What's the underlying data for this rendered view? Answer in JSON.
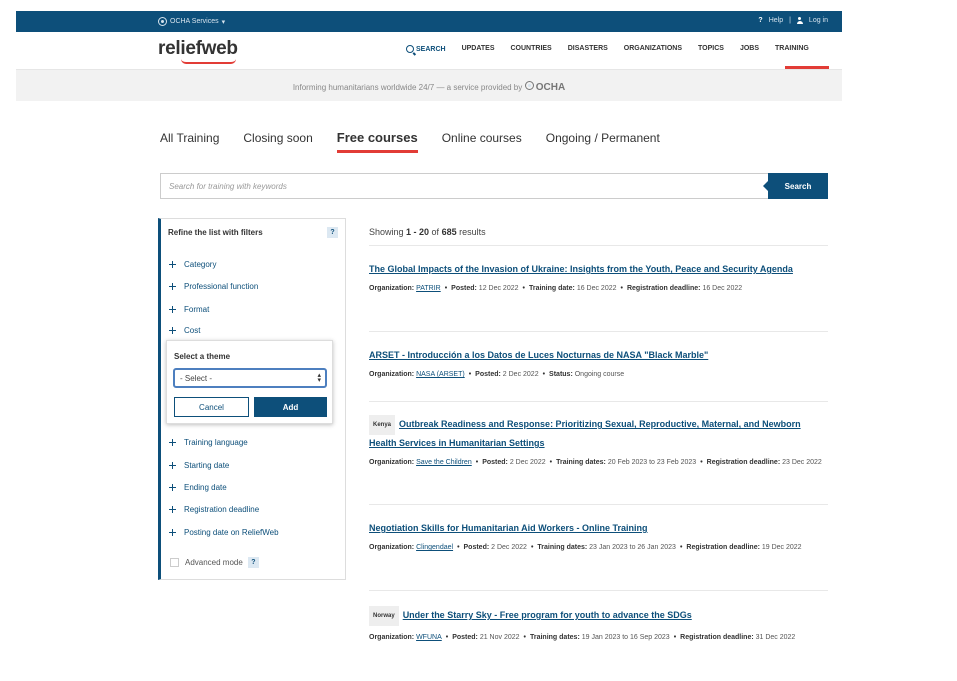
{
  "topbar": {
    "services": "OCHA Services",
    "help": "Help",
    "login": "Log in",
    "separator": "|"
  },
  "header": {
    "logo": "reliefweb",
    "nav": [
      "SEARCH",
      "UPDATES",
      "COUNTRIES",
      "DISASTERS",
      "ORGANIZATIONS",
      "TOPICS",
      "JOBS",
      "TRAINING"
    ],
    "active_nav": "TRAINING"
  },
  "tagline": {
    "text": "Informing humanitarians worldwide 24/7 — a service provided by",
    "brand": "OCHA"
  },
  "tabs": [
    "All Training",
    "Closing soon",
    "Free courses",
    "Online courses",
    "Ongoing / Permanent"
  ],
  "active_tab": "Free courses",
  "search": {
    "placeholder": "Search for training with keywords",
    "button": "Search"
  },
  "filters": {
    "heading": "Refine the list with filters",
    "help": "?",
    "items_top": [
      "Category",
      "Professional function",
      "Format",
      "Cost"
    ],
    "items_bottom": [
      "Training language",
      "Starting date",
      "Ending date",
      "Registration deadline",
      "Posting date on ReliefWeb"
    ],
    "advanced_mode": "Advanced mode",
    "popup": {
      "label": "Select a theme",
      "select_value": "- Select -",
      "cancel": "Cancel",
      "add": "Add"
    }
  },
  "results": {
    "showing_prefix": "Showing ",
    "range": "1 - 20",
    "of": " of ",
    "total": "685",
    "suffix": " results",
    "items": [
      {
        "tag": "",
        "title": "The Global Impacts of the Invasion of Ukraine: Insights from the Youth, Peace and Security Agenda",
        "meta": [
          {
            "label": "Organization:",
            "value": "PATRIR",
            "link": true
          },
          {
            "label": "Posted:",
            "value": "12 Dec 2022"
          },
          {
            "label": "Training date:",
            "value": "16 Dec 2022"
          },
          {
            "label": "Registration deadline:",
            "value": "16 Dec 2022"
          }
        ]
      },
      {
        "tag": "",
        "title": "ARSET - Introducción a los Datos de Luces Nocturnas de NASA \"Black Marble\"",
        "meta": [
          {
            "label": "Organization:",
            "value": "NASA (ARSET)",
            "link": true
          },
          {
            "label": "Posted:",
            "value": "2 Dec 2022"
          },
          {
            "label": "Status:",
            "value": "Ongoing course"
          }
        ]
      },
      {
        "tag": "Kenya",
        "title": "Outbreak Readiness and Response: Prioritizing Sexual, Reproductive, Maternal, and Newborn Health Services in Humanitarian Settings",
        "meta": [
          {
            "label": "Organization:",
            "value": "Save the Children",
            "link": true
          },
          {
            "label": "Posted:",
            "value": "2 Dec 2022"
          },
          {
            "label": "Training dates:",
            "value": "20 Feb 2023 to 23 Feb 2023"
          },
          {
            "label": "Registration deadline:",
            "value": "23 Dec 2022"
          }
        ]
      },
      {
        "tag": "",
        "title": "Negotiation Skills for Humanitarian Aid Workers - Online Training",
        "meta": [
          {
            "label": "Organization:",
            "value": "Clingendael",
            "link": true
          },
          {
            "label": "Posted:",
            "value": "2 Dec 2022"
          },
          {
            "label": "Training dates:",
            "value": "23 Jan 2023 to 26 Jan 2023"
          },
          {
            "label": "Registration deadline:",
            "value": "19 Dec 2022"
          }
        ]
      },
      {
        "tag": "Norway",
        "title": "Under the Starry Sky - Free program for youth to advance the SDGs",
        "meta": [
          {
            "label": "Organization:",
            "value": "WFUNA",
            "link": true
          },
          {
            "label": "Posted:",
            "value": "21 Nov 2022"
          },
          {
            "label": "Training dates:",
            "value": "19 Jan 2023 to 16 Sep 2023"
          },
          {
            "label": "Registration deadline:",
            "value": "31 Dec 2022"
          }
        ]
      }
    ]
  },
  "colors": {
    "brand_blue": "#0d4f7a",
    "accent_red": "#e23c36"
  }
}
